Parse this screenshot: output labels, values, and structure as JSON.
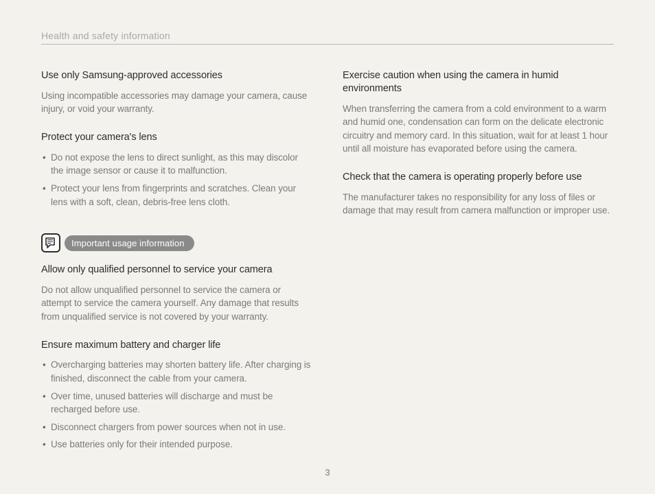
{
  "header": "Health and safety information",
  "page_number": "3",
  "left": {
    "s1": {
      "heading": "Use only Samsung-approved accessories",
      "body": "Using incompatible accessories may damage your camera, cause injury, or void your warranty."
    },
    "s2": {
      "heading": "Protect your camera's lens",
      "bullets": [
        "Do not expose the lens to direct sunlight, as this may discolor the image sensor or cause it to malfunction.",
        "Protect your lens from fingerprints and scratches. Clean your lens with a soft, clean, debris-free lens cloth."
      ]
    },
    "callout": {
      "label": "Important usage information"
    },
    "s3": {
      "heading": "Allow only qualified personnel to service your camera",
      "body": "Do not allow unqualified personnel to service the camera or attempt to service the camera yourself. Any damage that results from unqualified service is not covered by your warranty."
    },
    "s4": {
      "heading": "Ensure maximum battery and charger life",
      "bullets": [
        "Overcharging batteries may shorten battery life. After charging is finished, disconnect the cable from your camera.",
        "Over time, unused batteries will discharge and must be recharged before use.",
        "Disconnect chargers from power sources when not in use.",
        "Use batteries only for their intended purpose."
      ]
    }
  },
  "right": {
    "s1": {
      "heading": "Exercise caution when using the camera in humid environments",
      "body": "When transferring the camera from a cold environment to a warm and humid one, condensation can form on the delicate electronic circuitry and memory card. In this situation, wait for at least 1 hour until all moisture has evaporated before using the camera."
    },
    "s2": {
      "heading": "Check that the camera is operating properly before use",
      "body": "The manufacturer takes no responsibility for any loss of files or damage that may result from camera malfunction or improper use."
    }
  }
}
